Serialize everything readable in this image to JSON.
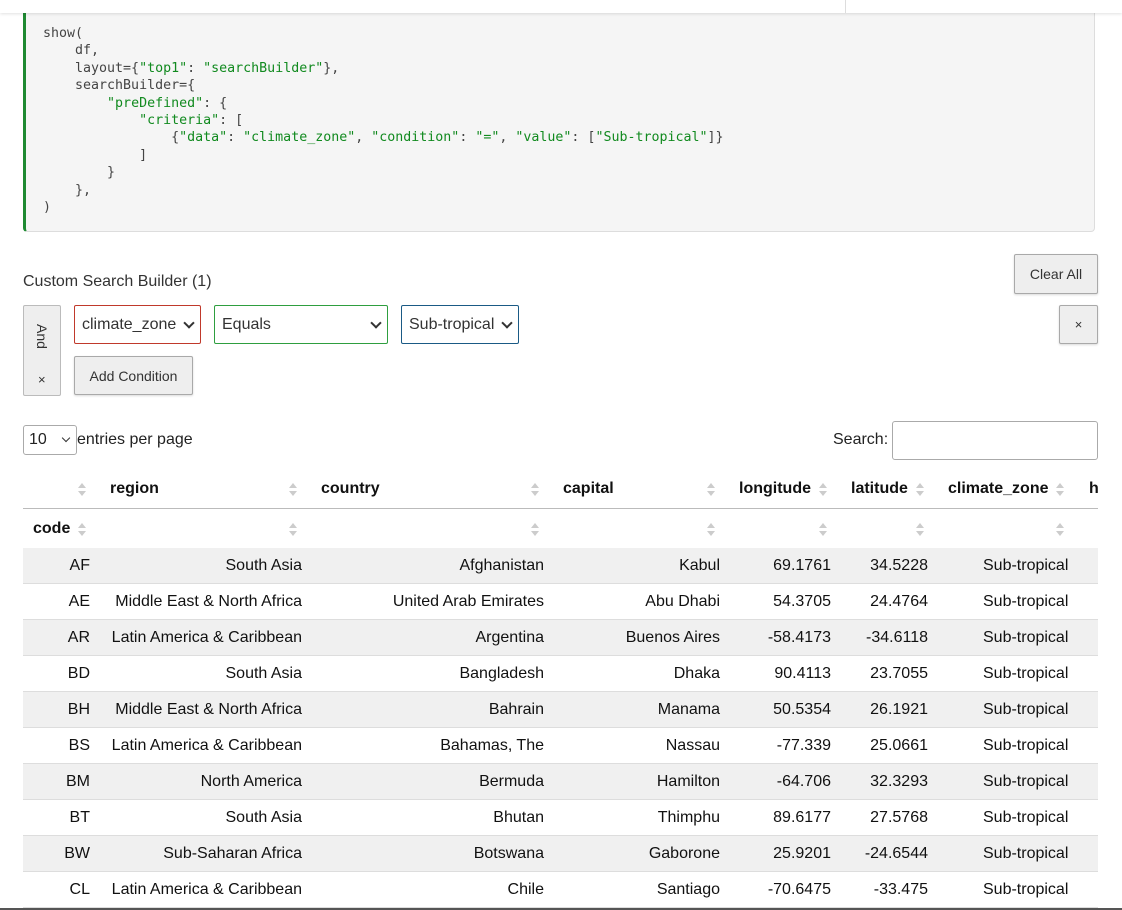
{
  "code": {
    "lines": [
      [
        {
          "t": "show("
        }
      ],
      [
        {
          "t": "    df,"
        }
      ],
      [
        {
          "t": "    layout={"
        },
        {
          "t": "\"top1\"",
          "s": 1
        },
        {
          "t": ": "
        },
        {
          "t": "\"searchBuilder\"",
          "s": 1
        },
        {
          "t": "},"
        }
      ],
      [
        {
          "t": "    searchBuilder={"
        }
      ],
      [
        {
          "t": "        "
        },
        {
          "t": "\"preDefined\"",
          "s": 1
        },
        {
          "t": ": {"
        }
      ],
      [
        {
          "t": "            "
        },
        {
          "t": "\"criteria\"",
          "s": 1
        },
        {
          "t": ": ["
        }
      ],
      [
        {
          "t": "                {"
        },
        {
          "t": "\"data\"",
          "s": 1
        },
        {
          "t": ": "
        },
        {
          "t": "\"climate_zone\"",
          "s": 1
        },
        {
          "t": ", "
        },
        {
          "t": "\"condition\"",
          "s": 1
        },
        {
          "t": ": "
        },
        {
          "t": "\"=\"",
          "s": 1
        },
        {
          "t": ", "
        },
        {
          "t": "\"value\"",
          "s": 1
        },
        {
          "t": ": ["
        },
        {
          "t": "\"Sub-tropical\"",
          "s": 1
        },
        {
          "t": "]}"
        }
      ],
      [
        {
          "t": "            ]"
        }
      ],
      [
        {
          "t": "        }"
        }
      ],
      [
        {
          "t": "    },"
        }
      ],
      [
        {
          "t": ")"
        }
      ]
    ]
  },
  "search_builder": {
    "title": "Custom Search Builder (1)",
    "clear_all_label": "Clear All",
    "logic_label": "And",
    "logic_remove_label": "×",
    "column_value": "climate_zone",
    "condition_value": "Equals",
    "value_value": "Sub-tropical",
    "delete_label": "×",
    "add_condition_label": "Add Condition",
    "colors": {
      "column_border": "#c0392b",
      "condition_border": "#2e9e3f",
      "value_border": "#1a5a85"
    }
  },
  "controls": {
    "page_length_value": "10",
    "page_length_label": "entries per page",
    "search_label": "Search:",
    "search_value": ""
  },
  "table": {
    "headers_top": [
      "region",
      "country",
      "capital",
      "longitude",
      "latitude",
      "climate_zone",
      "h"
    ],
    "header_second": "code",
    "rows": [
      [
        "AF",
        "South Asia",
        "Afghanistan",
        "Kabul",
        "69.1761",
        "34.5228",
        "Sub-tropical"
      ],
      [
        "AE",
        "Middle East & North Africa",
        "United Arab Emirates",
        "Abu Dhabi",
        "54.3705",
        "24.4764",
        "Sub-tropical"
      ],
      [
        "AR",
        "Latin America & Caribbean",
        "Argentina",
        "Buenos Aires",
        "-58.4173",
        "-34.6118",
        "Sub-tropical"
      ],
      [
        "BD",
        "South Asia",
        "Bangladesh",
        "Dhaka",
        "90.4113",
        "23.7055",
        "Sub-tropical"
      ],
      [
        "BH",
        "Middle East & North Africa",
        "Bahrain",
        "Manama",
        "50.5354",
        "26.1921",
        "Sub-tropical"
      ],
      [
        "BS",
        "Latin America & Caribbean",
        "Bahamas, The",
        "Nassau",
        "-77.339",
        "25.0661",
        "Sub-tropical"
      ],
      [
        "BM",
        "North America",
        "Bermuda",
        "Hamilton",
        "-64.706",
        "32.3293",
        "Sub-tropical"
      ],
      [
        "BT",
        "South Asia",
        "Bhutan",
        "Thimphu",
        "89.6177",
        "27.5768",
        "Sub-tropical"
      ],
      [
        "BW",
        "Sub-Saharan Africa",
        "Botswana",
        "Gaborone",
        "25.9201",
        "-24.6544",
        "Sub-tropical"
      ],
      [
        "CL",
        "Latin America & Caribbean",
        "Chile",
        "Santiago",
        "-70.6475",
        "-33.475",
        "Sub-tropical"
      ]
    ]
  }
}
